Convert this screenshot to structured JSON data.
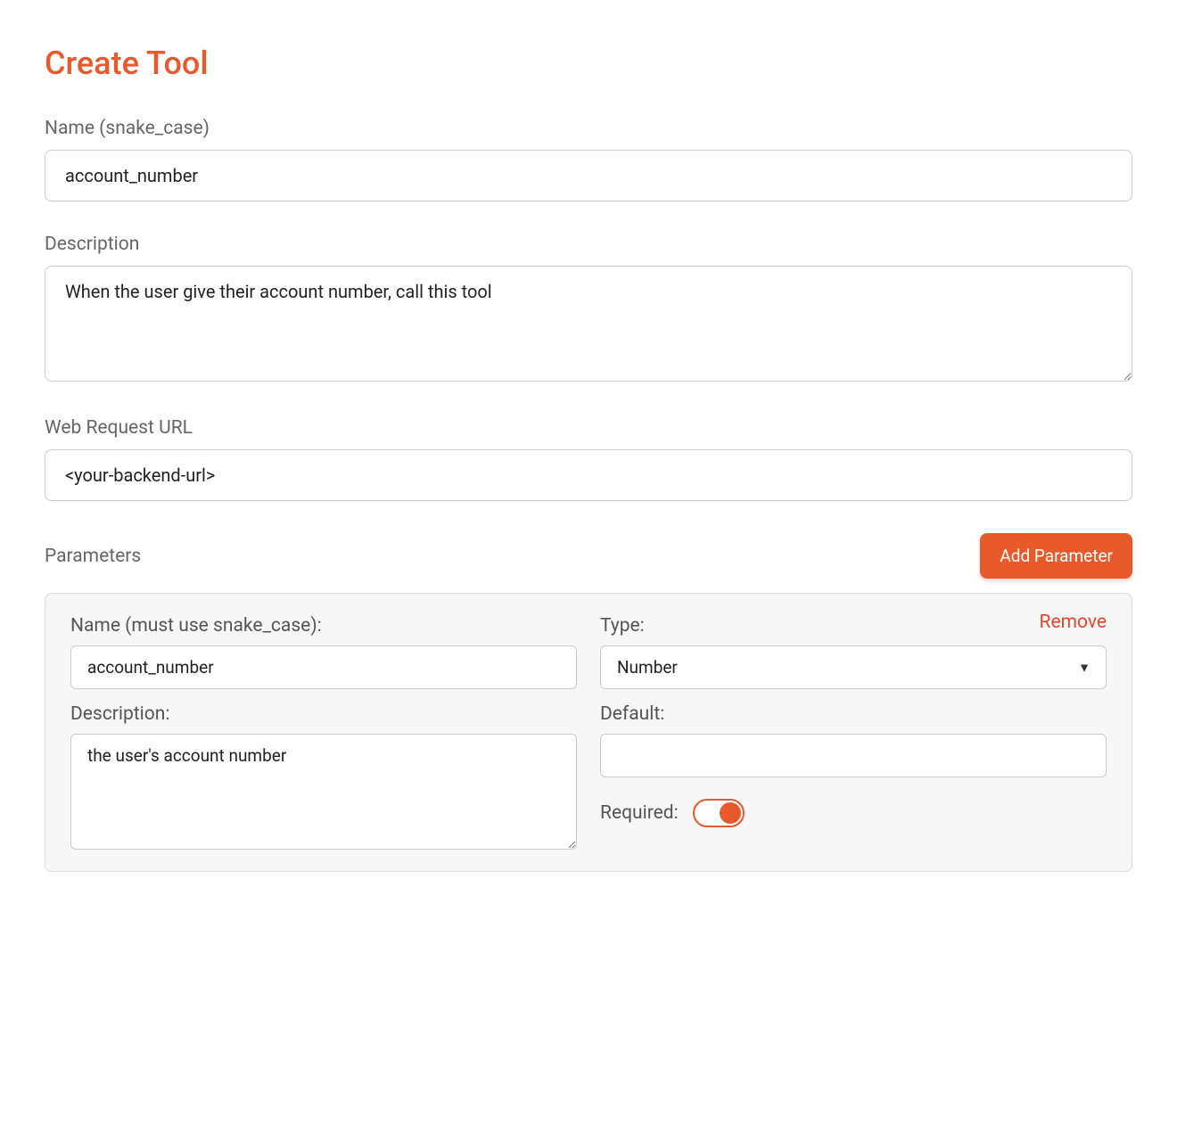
{
  "page": {
    "title": "Create Tool"
  },
  "fields": {
    "name": {
      "label": "Name (snake_case)",
      "value": "account_number"
    },
    "description": {
      "label": "Description",
      "value": "When the user give their account number, call this tool"
    },
    "web_request_url": {
      "label": "Web Request URL",
      "value": "<your-backend-url>"
    }
  },
  "parameters": {
    "section_label": "Parameters",
    "add_button_label": "Add Parameter",
    "remove_label": "Remove",
    "items": [
      {
        "name_label": "Name (must use snake_case):",
        "name_value": "account_number",
        "description_label": "Description:",
        "description_value": "the user's account number",
        "type_label": "Type:",
        "type_value": "Number",
        "default_label": "Default:",
        "default_value": "",
        "required_label": "Required:",
        "required": true
      }
    ]
  },
  "colors": {
    "accent": "#e8592b"
  }
}
